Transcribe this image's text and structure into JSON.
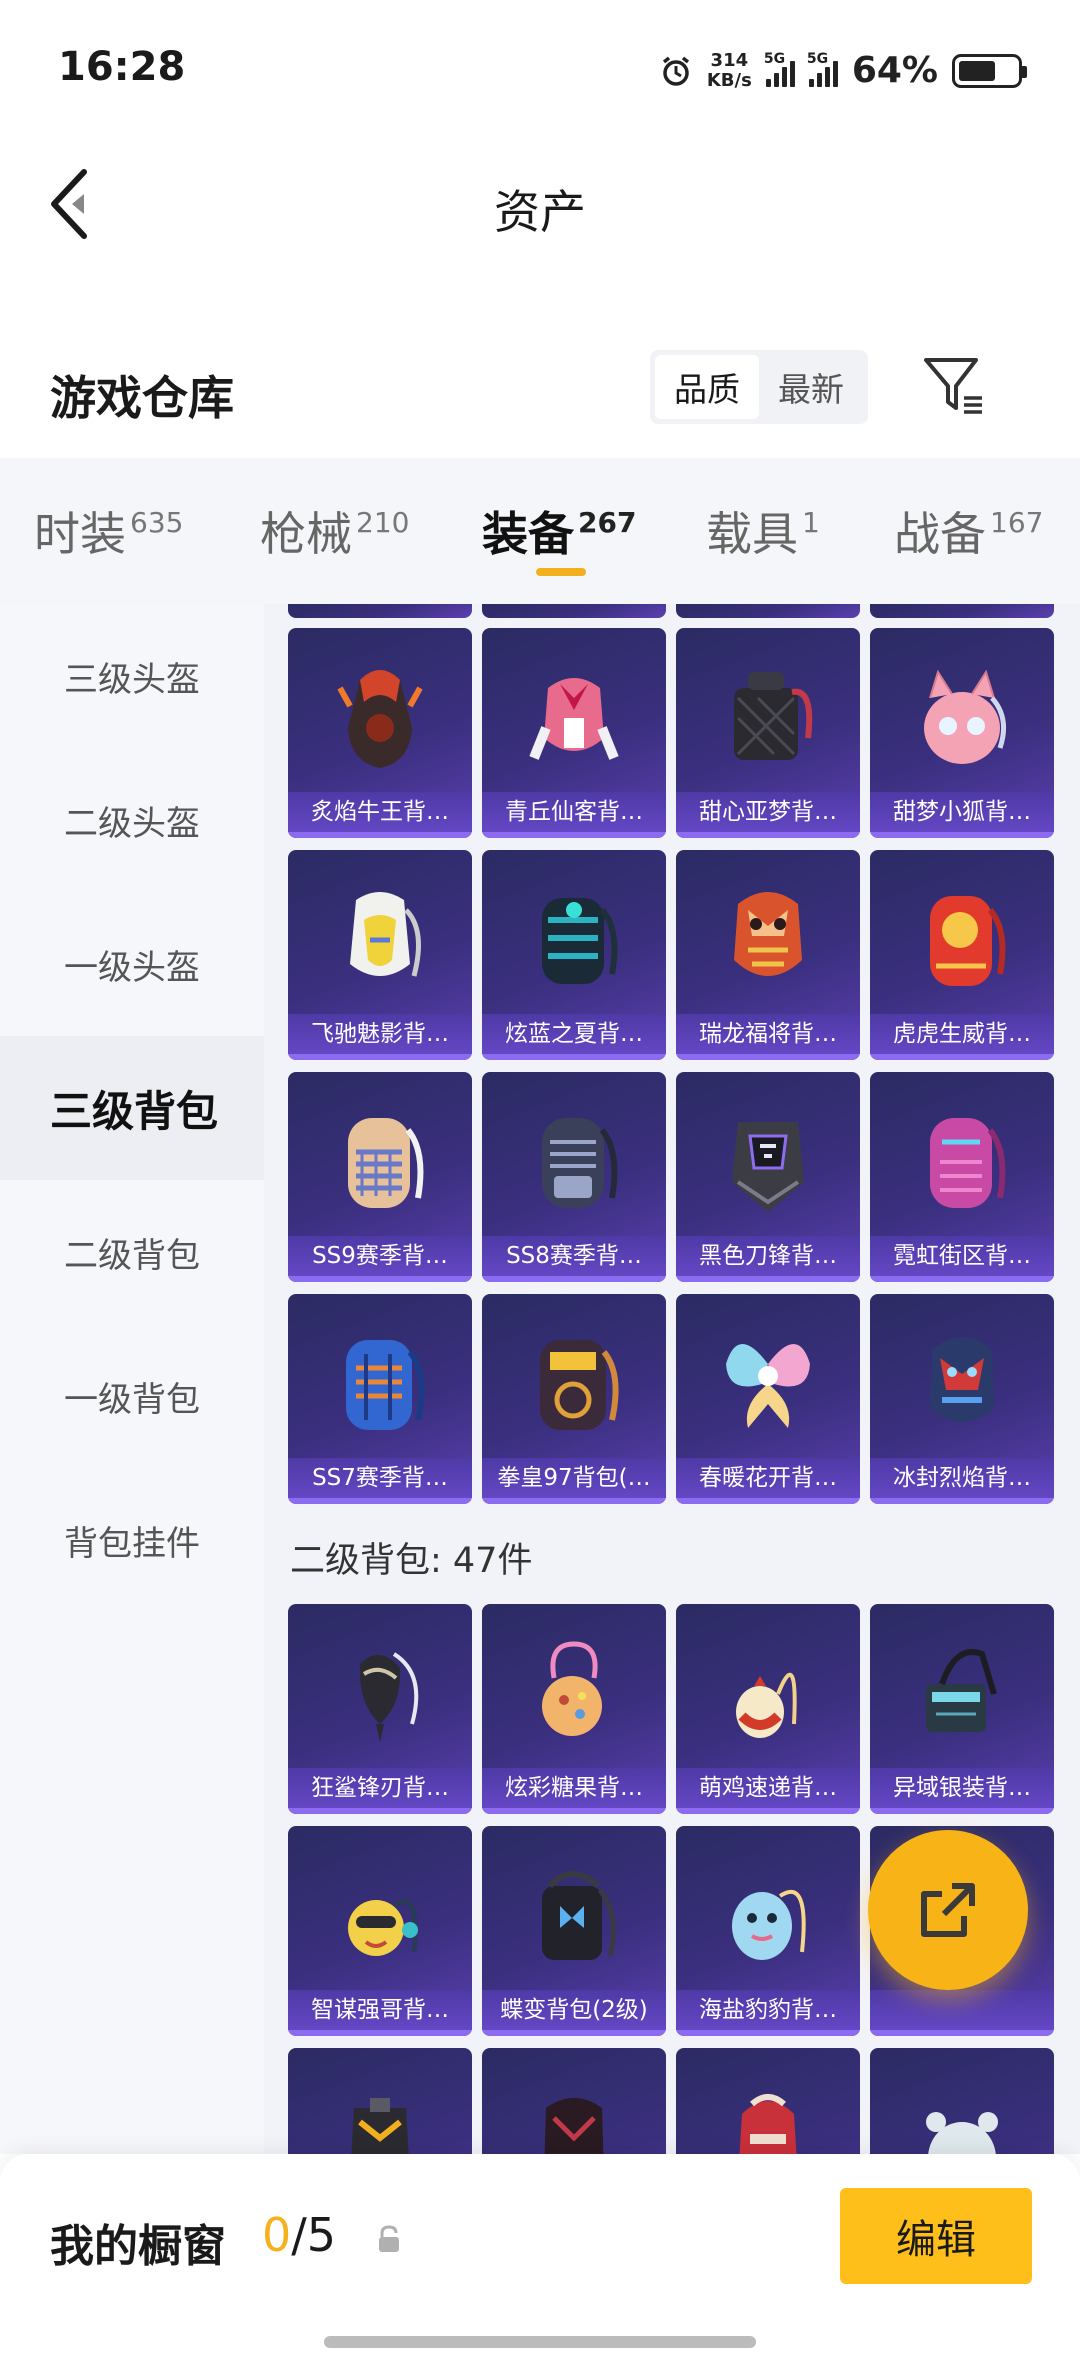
{
  "status_bar": {
    "time": "16:28",
    "net_speed_value": "314",
    "net_speed_unit": "KB/s",
    "sim1_tag": "5G",
    "sim2_tag": "5G",
    "battery_percent": "64%",
    "battery_level": 0.64
  },
  "header": {
    "title": "资产",
    "back_icon": "chevron-left-icon"
  },
  "warehouse": {
    "title": "游戏仓库",
    "sort_options": [
      "品质",
      "最新"
    ],
    "sort_selected": "品质",
    "filter_icon": "filter-icon"
  },
  "tabs": [
    {
      "label": "时装",
      "count": "635"
    },
    {
      "label": "枪械",
      "count": "210"
    },
    {
      "label": "装备",
      "count": "267",
      "active": true
    },
    {
      "label": "载具",
      "count": "1"
    },
    {
      "label": "战备",
      "count": "167"
    }
  ],
  "sidebar": {
    "items": [
      "三级头盔",
      "二级头盔",
      "一级头盔",
      "三级背包",
      "二级背包",
      "一级背包",
      "背包挂件"
    ],
    "active": "三级背包"
  },
  "grid": {
    "tier3_items": [
      "炙焰牛王背…",
      "青丘仙客背…",
      "甜心亚梦背…",
      "甜梦小狐背…",
      "飞驰魅影背…",
      "炫蓝之夏背…",
      "瑞龙福将背…",
      "虎虎生威背…",
      "SS9赛季背…",
      "SS8赛季背…",
      "黑色刀锋背…",
      "霓虹街区背…",
      "SS7赛季背…",
      "拳皇97背包(…",
      "春暖花开背…",
      "冰封烈焰背…"
    ],
    "section_title": "二级背包: 47件",
    "tier2_items": [
      "狂鲨锋刃背…",
      "炫彩糖果背…",
      "萌鸡速递背…",
      "异域银装背…",
      "智谋强哥背…",
      "蝶变背包(2级)",
      "海盐豹豹背…",
      ""
    ]
  },
  "fab": {
    "icon": "share-icon"
  },
  "bottom_bar": {
    "label": "我的橱窗",
    "count_current": "0",
    "count_total": "/5",
    "lock_icon": "lock-icon",
    "edit_label": "编辑"
  },
  "colors": {
    "accent": "#f5b21e",
    "card_bg": "#3a2f7e",
    "card_label": "#5b42b8"
  }
}
